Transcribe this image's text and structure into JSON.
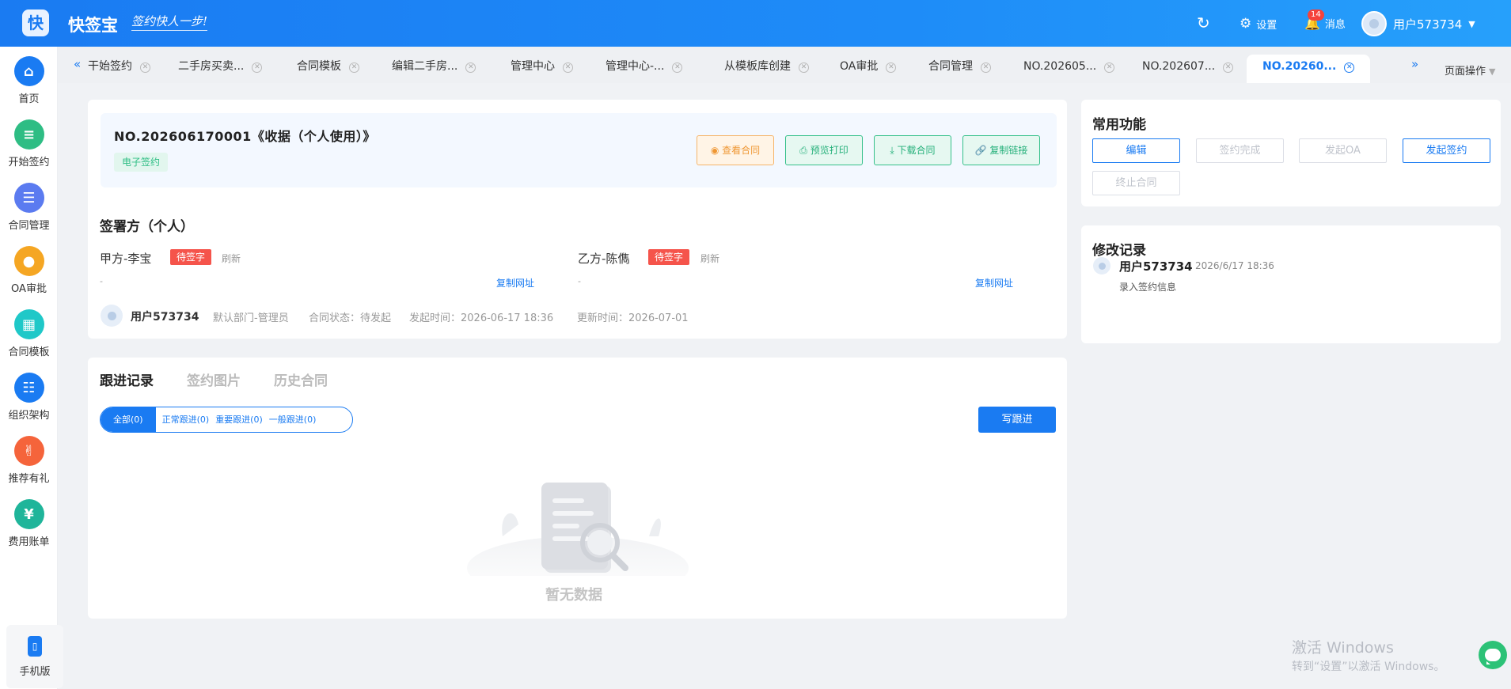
{
  "header": {
    "logo_glyph": "快",
    "brand": "快签宝",
    "slogan": "签约快人一步!",
    "settings_label": "设置",
    "messages_label": "消息",
    "messages_badge": "14",
    "user_name": "用户573734",
    "accent_color": "#1a7bf2"
  },
  "sidebar": {
    "items": [
      {
        "label": "首页",
        "icon": "home-icon",
        "color": "#1a7bf2"
      },
      {
        "label": "开始签约",
        "icon": "contract-start-icon",
        "color": "#2ebd84"
      },
      {
        "label": "合同管理",
        "icon": "contract-manage-icon",
        "color": "#5b7bf0"
      },
      {
        "label": "OA审批",
        "icon": "oa-approval-icon",
        "color": "#f5a623"
      },
      {
        "label": "合同模板",
        "icon": "template-icon",
        "color": "#1fc8c8"
      },
      {
        "label": "组织架构",
        "icon": "org-icon",
        "color": "#1a7bf2"
      },
      {
        "label": "推荐有礼",
        "icon": "thumbs-up-icon",
        "color": "#f5643b"
      },
      {
        "label": "费用账单",
        "icon": "bill-icon",
        "color": "#1fb59a"
      }
    ],
    "mobile_label": "手机版"
  },
  "tabs": {
    "items": [
      {
        "label": "干始签约"
      },
      {
        "label": "二手房买卖..."
      },
      {
        "label": "合同模板"
      },
      {
        "label": "编辑二手房..."
      },
      {
        "label": "管理中心"
      },
      {
        "label": "管理中心-..."
      },
      {
        "label": "从模板库创建"
      },
      {
        "label": "OA审批"
      },
      {
        "label": "合同管理"
      },
      {
        "label": "NO.202605..."
      },
      {
        "label": "NO.202607..."
      },
      {
        "label": "NO.20260..."
      }
    ],
    "page_ops_label": "页面操作"
  },
  "contract": {
    "title": "NO.202606170001《收据（个人使用）》",
    "tag": "电子签约",
    "actions": {
      "view": "查看合同",
      "print": "预览打印",
      "download": "下载合同",
      "copy_link": "复制链接"
    }
  },
  "signers": {
    "section_title": "签署方（个人）",
    "party_a": {
      "name": "甲方-李宝",
      "status": "待签字",
      "refresh": "刷新",
      "dash": "-",
      "copy": "复制网址"
    },
    "party_b": {
      "name": "乙方-陈儁",
      "status": "待签字",
      "refresh": "刷新",
      "dash": "-",
      "copy": "复制网址"
    }
  },
  "meta": {
    "user": "用户573734",
    "dept": "默认部门-管理员",
    "status": "合同状态：待发起",
    "start_time": "发起时间：2026-06-17 18:36",
    "update_time": "更新时间：2026-07-01"
  },
  "follow": {
    "tabs": [
      "跟进记录",
      "签约图片",
      "历史合同"
    ],
    "filters": [
      "全部(0)",
      "正常跟进(0)",
      "重要跟进(0)",
      "一般跟进(0)"
    ],
    "write_button": "写跟进",
    "empty_text": "暂无数据"
  },
  "functions": {
    "title": "常用功能",
    "edit": "编辑",
    "sign_complete": "签约完成",
    "start_oa": "发起OA",
    "start_sign": "发起签约",
    "terminate": "终止合同"
  },
  "log": {
    "title": "修改记录",
    "user": "用户573734",
    "time": "2026/6/17 18:36",
    "desc": "录入签约信息"
  },
  "watermark": {
    "line1": "激活 Windows",
    "line2": "转到“设置”以激活 Windows。"
  }
}
